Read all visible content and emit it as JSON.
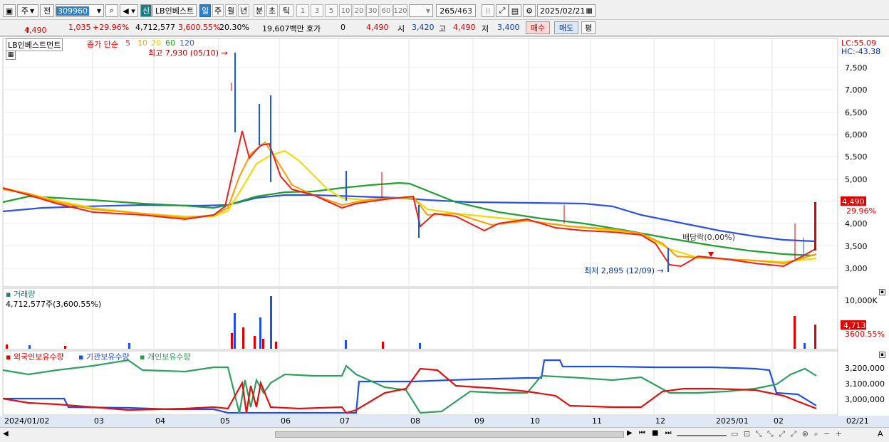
{
  "toolbar": {
    "mode_label": "주",
    "prev_label": "전",
    "code_value": "309960",
    "badge_label": "신",
    "stock_name": "LB인베스트",
    "period_buttons": [
      "일",
      "주",
      "월",
      "년",
      "분",
      "초",
      "틱"
    ],
    "interval_buttons": [
      "1",
      "3",
      "5",
      "10",
      "20",
      "30",
      "60",
      "120"
    ],
    "count_value": "265",
    "count_total": "/463",
    "date_value": "2025/02/21"
  },
  "quote": {
    "price": "4,490",
    "change": "1,035",
    "change_pct": "+29.96%",
    "volume": "4,712,577",
    "volume_pct": "3,600.55%",
    "turnover_pct": "20.30%",
    "amount": "19,607백만",
    "hoga_label": "호가",
    "hoga_value": "0",
    "hoga_price": "4,490",
    "open_label": "시",
    "open_value": "3,420",
    "high_label": "고",
    "high_value": "4,490",
    "low_label": "저",
    "low_value": "3,400",
    "buy_label": "매수",
    "sell_label": "매도",
    "flat_label": "평"
  },
  "price_panel": {
    "name_label": "LB인베스트먼트",
    "legend_prefix": "종가 단순",
    "ma_labels": [
      "5",
      "10",
      "20",
      "60",
      "120"
    ],
    "ma_colors": [
      "#ff3030",
      "#ffa500",
      "#e8d000",
      "#19a019",
      "#3050ff"
    ],
    "lc_label": "LC:55.09",
    "hc_label": "HC:-43.38",
    "high_annotation": "최고 7,930 (05/10)",
    "low_annotation": "최저 2,895 (12/09)",
    "dividend_annotation": "배당락(0.00%)",
    "current_price_tag": "4,490",
    "current_pct_tag": "29.96%",
    "y_ticks": [
      "7,500",
      "7,000",
      "6,500",
      "6,000",
      "5,500",
      "5,000",
      "4,500",
      "4,000",
      "3,500",
      "3,000"
    ]
  },
  "volume_panel": {
    "title": "거래량",
    "info": "4,712,577주(3,600.55%)",
    "y_tick": "10,000K",
    "current_tag": "4,713K",
    "current_pct": "3600.55%"
  },
  "holding_panel": {
    "legend": [
      "외국인보유수량",
      "기관보유수량",
      "개인보유수량"
    ],
    "legend_colors": [
      "#e00000",
      "#2050e0",
      "#2a9a50"
    ],
    "y_ticks": [
      "3,200,000",
      "3,100,000",
      "3,000,000"
    ]
  },
  "x_axis": {
    "labels": [
      "2024/01/02",
      "03",
      "04",
      "05",
      "06",
      "07",
      "08",
      "09",
      "10",
      "11",
      "12",
      "2025/01",
      "02"
    ],
    "right_label": "02/21"
  },
  "chart_data": {
    "type": "line",
    "title": "LB인베스트먼트",
    "categories": [
      "2024/01",
      "03",
      "04",
      "05",
      "06",
      "07",
      "08",
      "09",
      "10",
      "11",
      "12",
      "2025/01",
      "02",
      "02/21"
    ],
    "series": [
      {
        "name": "종가",
        "values": [
          4800,
          4380,
          4200,
          4200,
          5950,
          4550,
          4600,
          4200,
          4050,
          3950,
          3100,
          3200,
          3150,
          4490
        ]
      },
      {
        "name": "120",
        "values": [
          4300,
          4350,
          4400,
          4450,
          4650,
          4680,
          4650,
          4600,
          4600,
          4550,
          4200,
          3950,
          3650,
          3600
        ]
      }
    ],
    "ylim": [
      2800,
      8000
    ],
    "high": {
      "value": 7930,
      "date": "05/10"
    },
    "low": {
      "value": 2895,
      "date": "12/09"
    }
  }
}
